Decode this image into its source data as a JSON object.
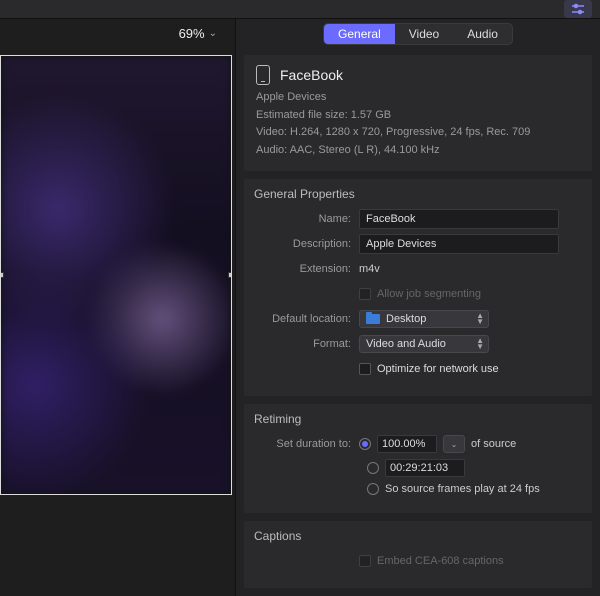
{
  "topbar": {
    "tool_icon": "inspector-toggle"
  },
  "preview": {
    "zoom": "69%"
  },
  "inspector": {
    "tabs": {
      "general": "General",
      "video": "Video",
      "audio": "Audio"
    },
    "summary": {
      "title": "FaceBook",
      "subtitle": "Apple Devices",
      "filesize_line": "Estimated file size: 1.57 GB",
      "video_line": "Video: H.264, 1280 x 720, Progressive, 24 fps, Rec. 709",
      "audio_line": "Audio: AAC, Stereo (L R), 44.100 kHz"
    },
    "general_props": {
      "section_title": "General Properties",
      "labels": {
        "name": "Name:",
        "description": "Description:",
        "extension": "Extension:",
        "allow_segmenting": "Allow job segmenting",
        "default_location": "Default location:",
        "format": "Format:",
        "optimize": "Optimize for network use"
      },
      "values": {
        "name": "FaceBook",
        "description": "Apple Devices",
        "extension": "m4v",
        "default_location": "Desktop",
        "format": "Video and Audio"
      }
    },
    "retiming": {
      "section_title": "Retiming",
      "set_duration_label": "Set duration to:",
      "percent": "100.00%",
      "of_source": "of source",
      "timecode": "00:29:21:03",
      "frames_line": "So source frames play at 24 fps"
    },
    "captions": {
      "section_title": "Captions",
      "embed_label": "Embed CEA-608 captions"
    }
  }
}
